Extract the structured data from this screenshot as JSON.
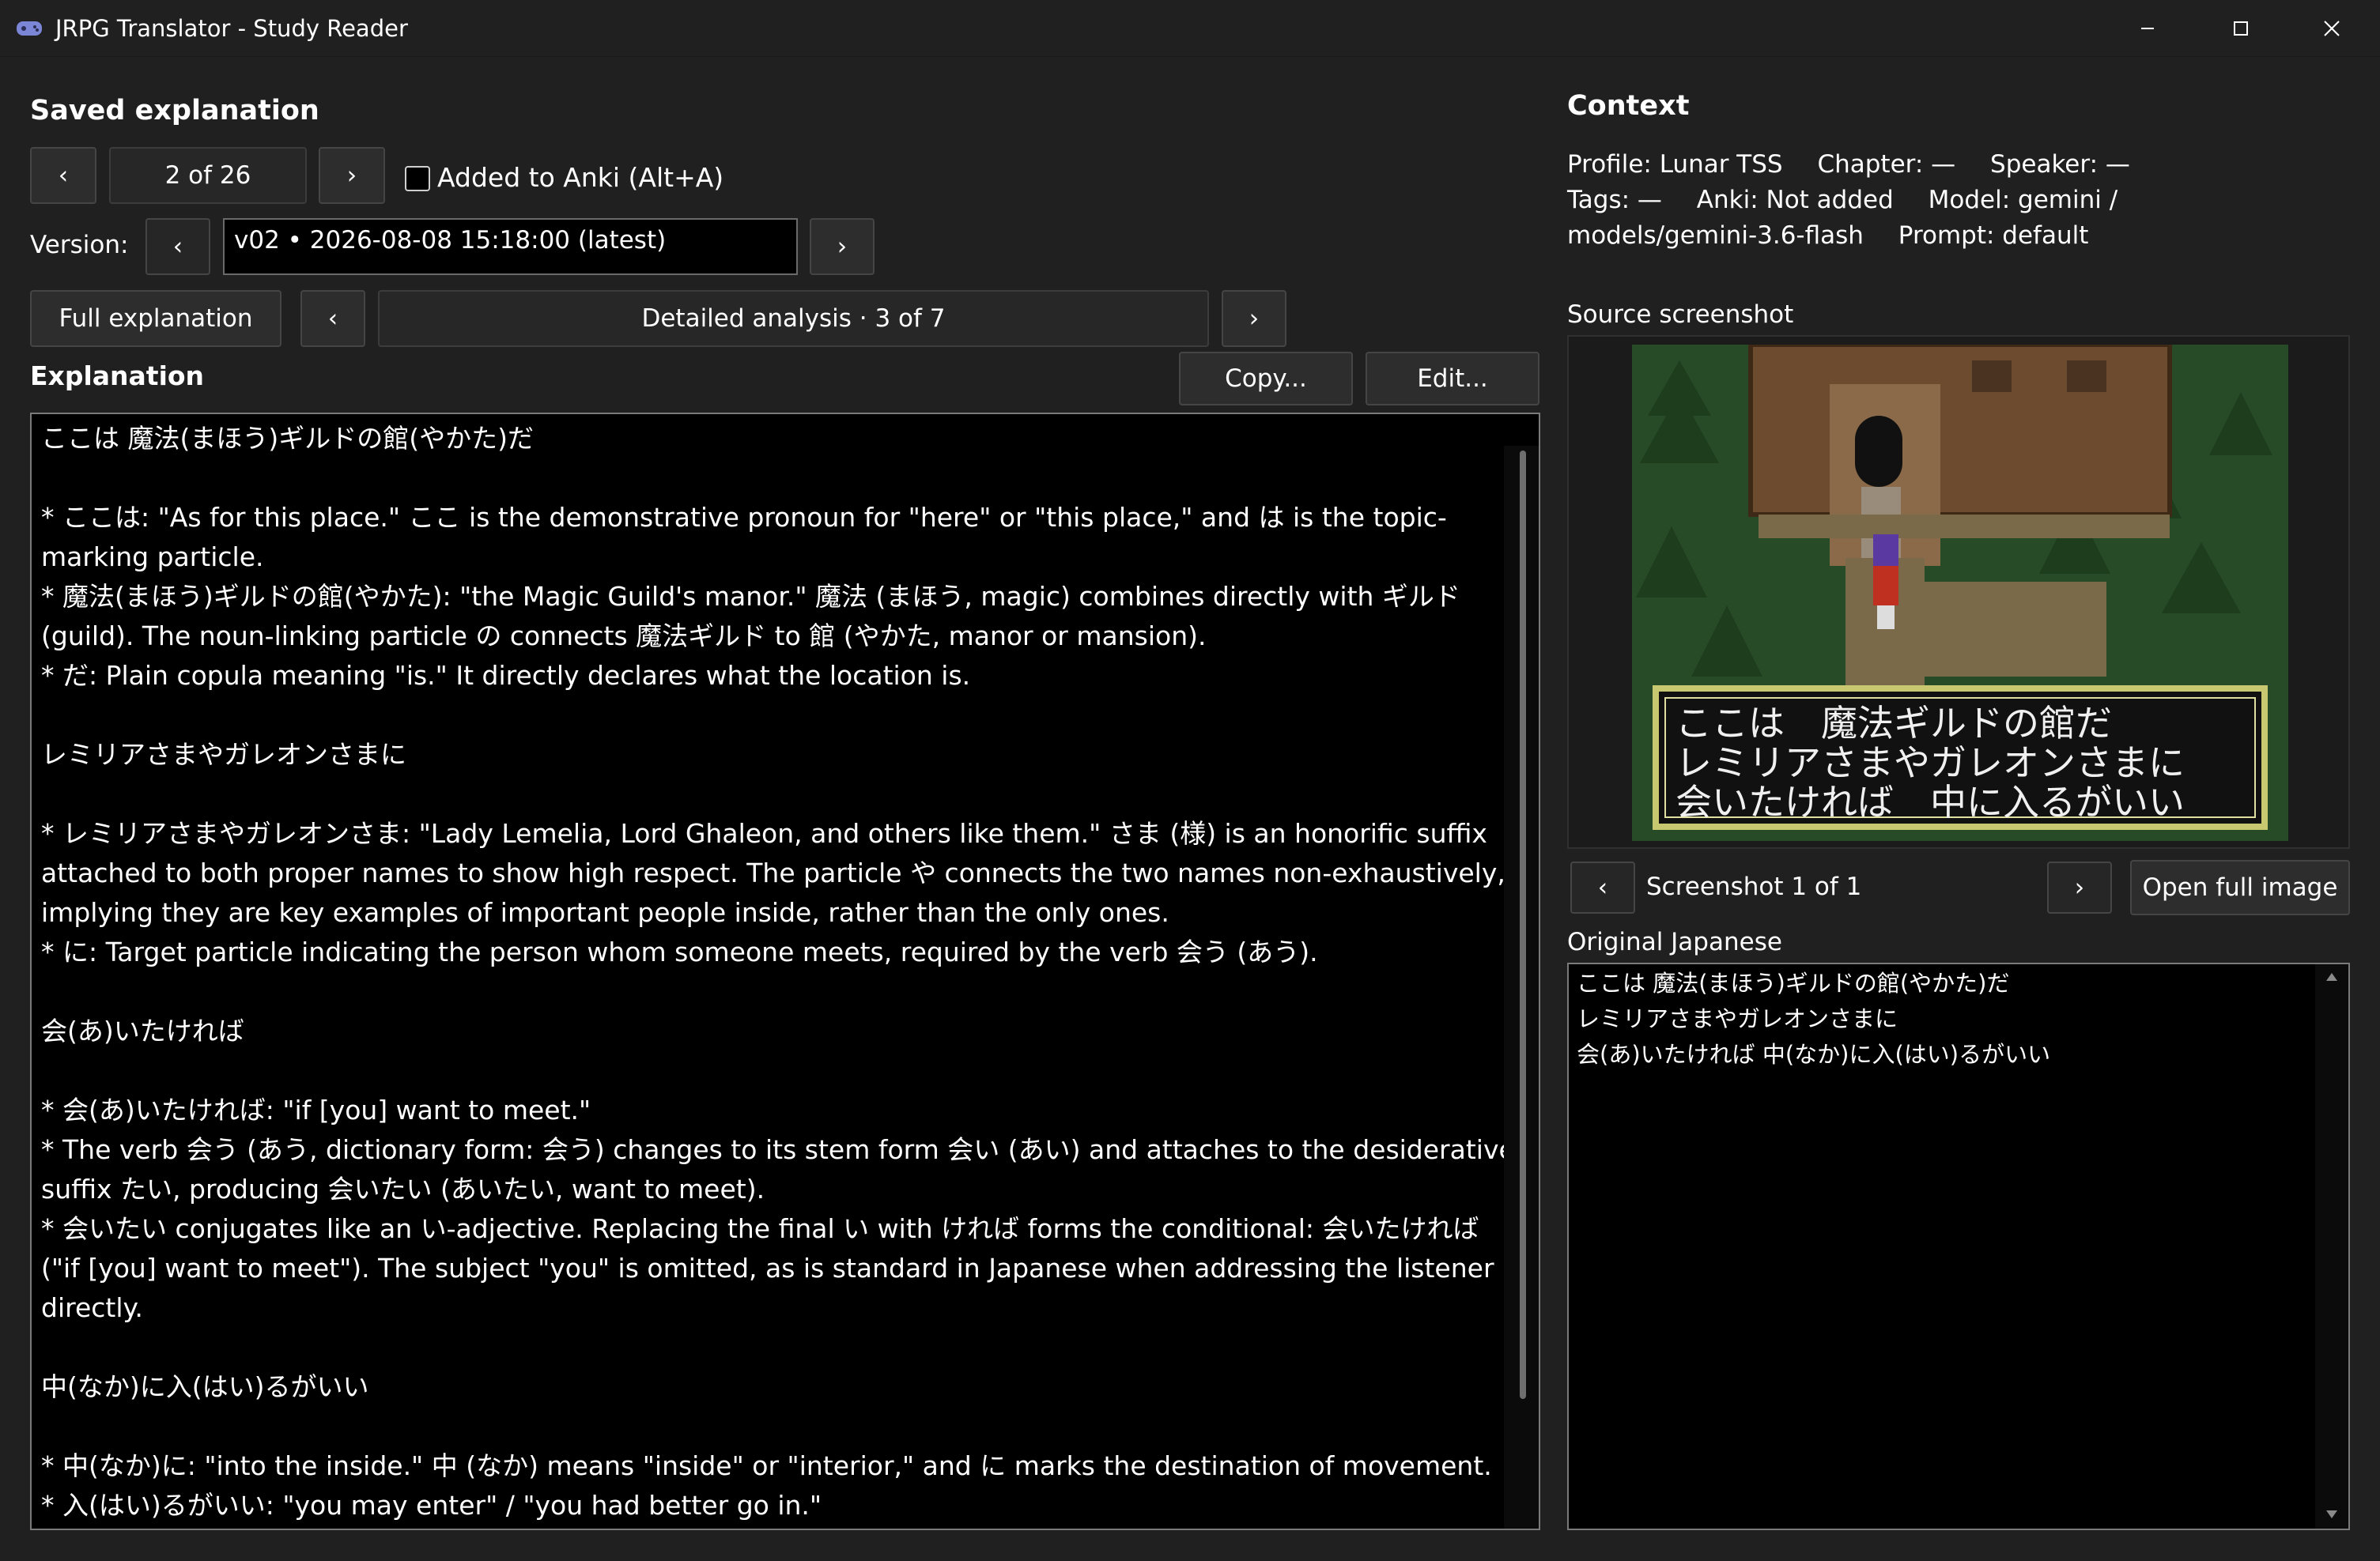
{
  "window": {
    "title": "JRPG Translator - Study Reader",
    "minimize_glyph": "—",
    "maximize_glyph": "☐",
    "close_glyph": "✕"
  },
  "left": {
    "heading": "Saved explanation",
    "prev_glyph": "‹",
    "next_glyph": "›",
    "counter": "2 of 26",
    "anki_checkbox_label": "Added to Anki  (Alt+A)",
    "anki_checked": false,
    "version_label": "Version:",
    "version_value": "v02  •  2026-08-08 15:18:00  (latest)",
    "full_explanation_button": "Full explanation",
    "section_title": "Detailed analysis  ·  3 of 7",
    "explanation_label": "Explanation",
    "copy_button": "Copy...",
    "edit_button": "Edit...",
    "explanation_text": "ここは 魔法(まほう)ギルドの館(やかた)だ\n\n* ここは: \"As for this place.\" ここ is the demonstrative pronoun for \"here\" or \"this place,\" and は is the topic-marking particle.\n* 魔法(まほう)ギルドの館(やかた): \"the Magic Guild's manor.\" 魔法 (まほう, magic) combines directly with ギルド (guild). The noun-linking particle の connects 魔法ギルド to 館 (やかた, manor or mansion).\n* だ: Plain copula meaning \"is.\" It directly declares what the location is.\n\nレミリアさまやガレオンさまに\n\n* レミリアさまやガレオンさま: \"Lady Lemelia, Lord Ghaleon, and others like them.\" さま (様) is an honorific suffix attached to both proper names to show high respect. The particle や connects the two names non-exhaustively, implying they are key examples of important people inside, rather than the only ones.\n* に: Target particle indicating the person whom someone meets, required by the verb 会う (あう).\n\n会(あ)いたければ\n\n* 会(あ)いたければ: \"if [you] want to meet.\"\n* The verb 会う (あう, dictionary form: 会う) changes to its stem form 会い (あい) and attaches to the desiderative suffix たい, producing 会いたい (あいたい, want to meet).\n* 会いたい conjugates like an い-adjective. Replacing the final い with ければ forms the conditional: 会いたければ (\"if [you] want to meet\"). The subject \"you\" is omitted, as is standard in Japanese when addressing the listener directly.\n\n中(なか)に入(はい)るがいい\n\n* 中(なか)に: \"into the inside.\" 中 (なか) means \"inside\" or \"interior,\" and に marks the destination of movement.\n* 入(はい)るがいい: \"you may enter\" / \"you had better go in.\""
  },
  "right": {
    "heading": "Context",
    "profile": "Profile: Lunar TSS",
    "chapter": "Chapter: —",
    "speaker": "Speaker: —",
    "tags": "Tags: —",
    "anki": "Anki: Not added",
    "model_line1": "Model: gemini /",
    "model_line2": "models/gemini-3.6-flash",
    "prompt": "Prompt: default",
    "source_label": "Source screenshot",
    "dialogue_lines": [
      "ここは　魔法ギルドの館だ",
      "レミリアさまやガレオンさまに",
      "会いたければ　中に入るがいい"
    ],
    "screenshot_counter": "Screenshot 1 of 1",
    "open_full_button": "Open full image",
    "original_label": "Original Japanese",
    "original_text": "ここは 魔法(まほう)ギルドの館(やかた)だ\nレミリアさまやガレオンさまに\n会(あ)いたければ 中(なか)に入(はい)るがいい",
    "colors": {
      "background": "#202020",
      "textbox": "#000000",
      "button": "#2d2d2d"
    }
  }
}
